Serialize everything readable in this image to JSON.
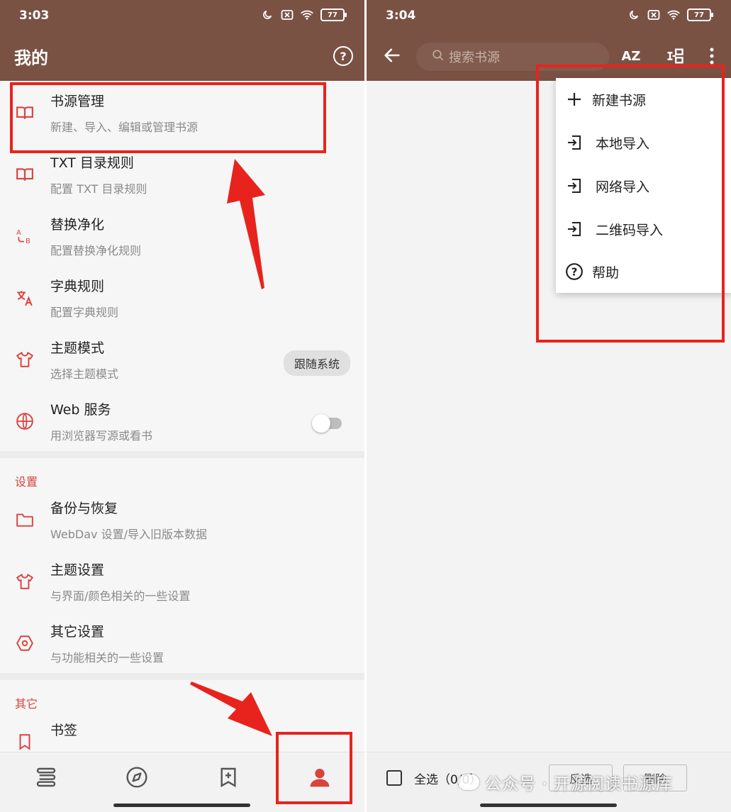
{
  "left": {
    "status": {
      "time": "3:03",
      "battery": "77"
    },
    "title": "我的",
    "help_icon": "help-circle-icon",
    "items": [
      {
        "title": "书源管理",
        "subtitle": "新建、导入、编辑或管理书源",
        "icon": "book-open-icon"
      },
      {
        "title": "TXT 目录规则",
        "subtitle": "配置 TXT 目录规则",
        "icon": "book-open-icon"
      },
      {
        "title": "替换净化",
        "subtitle": "配置替换净化规则",
        "icon": "replace-ab-icon"
      },
      {
        "title": "字典规则",
        "subtitle": "配置字典规则",
        "icon": "translate-icon"
      },
      {
        "title": "主题模式",
        "subtitle": "选择主题模式",
        "icon": "shirt-icon",
        "value": "跟随系统"
      },
      {
        "title": "Web 服务",
        "subtitle": "用浏览器写源或看书",
        "icon": "globe-icon",
        "toggle": false
      }
    ],
    "settings_header": "设置",
    "settings_items": [
      {
        "title": "备份与恢复",
        "subtitle": "WebDav 设置/导入旧版本数据",
        "icon": "folder-icon"
      },
      {
        "title": "主题设置",
        "subtitle": "与界面/颜色相关的一些设置",
        "icon": "shirt-icon"
      },
      {
        "title": "其它设置",
        "subtitle": "与功能相关的一些设置",
        "icon": "settings-hex-icon"
      }
    ],
    "other_header": "其它",
    "other_items": [
      {
        "title": "书签",
        "icon": "bookmark-icon"
      }
    ],
    "bottom_nav": [
      {
        "name": "bookshelf",
        "icon": "bookshelf-icon"
      },
      {
        "name": "discover",
        "icon": "compass-icon"
      },
      {
        "name": "rss",
        "icon": "bookmark-plus-icon"
      },
      {
        "name": "my",
        "icon": "person-icon",
        "active": true
      }
    ]
  },
  "right": {
    "status": {
      "time": "3:04",
      "battery": "77"
    },
    "search": {
      "placeholder": "搜索书源"
    },
    "toolbar": {
      "sort_label": "AZ"
    },
    "menu": [
      {
        "label": "新建书源",
        "icon": "plus-icon"
      },
      {
        "label": "本地导入",
        "icon": "import-icon"
      },
      {
        "label": "网络导入",
        "icon": "import-icon"
      },
      {
        "label": "二维码导入",
        "icon": "import-icon"
      },
      {
        "label": "帮助",
        "icon": "help-circle-icon"
      }
    ],
    "bottom": {
      "select_all": "全选（0/0）",
      "invert": "反选",
      "delete": "删除"
    }
  },
  "watermark": "公众号 · 开源阅读书源库",
  "colors": {
    "appbar": "#7a5244",
    "accent": "#d9433e",
    "annotation": "#e8231d"
  }
}
